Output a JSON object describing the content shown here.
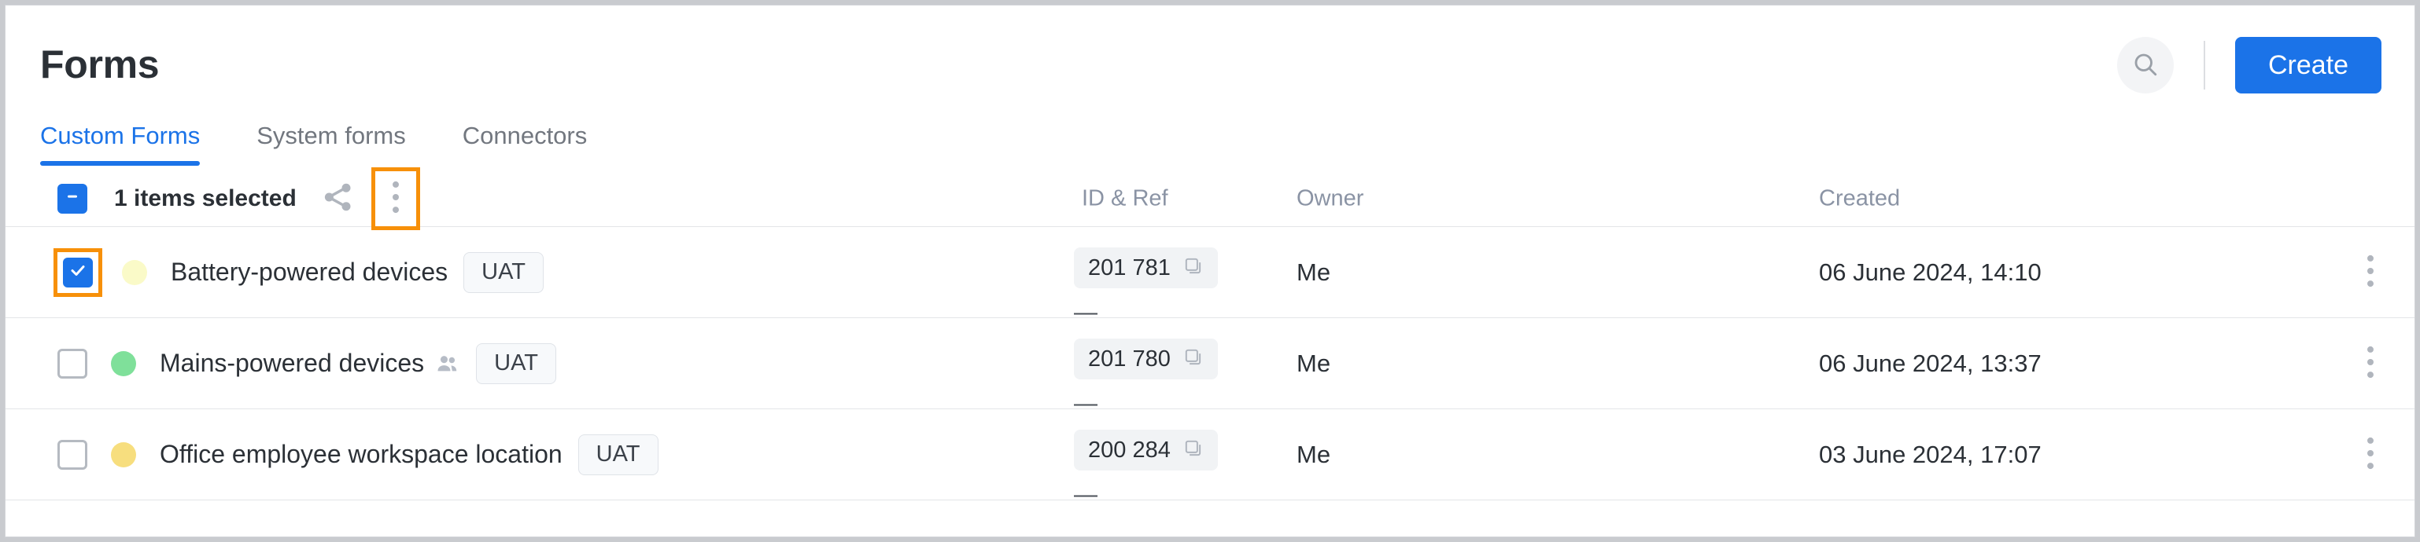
{
  "header": {
    "title": "Forms",
    "search_icon": "search-icon",
    "create_label": "Create"
  },
  "tabs": [
    {
      "label": "Custom Forms",
      "active": true
    },
    {
      "label": "System forms",
      "active": false
    },
    {
      "label": "Connectors",
      "active": false
    }
  ],
  "toolbar": {
    "selection_state": "indeterminate",
    "selected_label": "1 items selected",
    "share_icon": "share-icon",
    "more_icon": "kebab-menu-icon",
    "more_highlighted": true
  },
  "columns": {
    "id_ref": "ID & Ref",
    "owner": "Owner",
    "created": "Created"
  },
  "colors": {
    "accent_blue": "#1b73e8",
    "annotation_orange": "#f79009",
    "status_pale_yellow": "#fafac8",
    "status_green": "#7fe09a",
    "status_amber": "#f7de7e",
    "header_text": "#8a93a4"
  },
  "rows": [
    {
      "checked": true,
      "checkbox_highlighted": true,
      "status_color": "#fafac8",
      "name": "Battery-powered devices",
      "shared": false,
      "badge": "UAT",
      "id": "201 781",
      "ref": "—",
      "owner": "Me",
      "created": "06 June 2024, 14:10"
    },
    {
      "checked": false,
      "checkbox_highlighted": false,
      "status_color": "#7fe09a",
      "name": "Mains-powered devices",
      "shared": true,
      "badge": "UAT",
      "id": "201 780",
      "ref": "—",
      "owner": "Me",
      "created": "06 June 2024, 13:37"
    },
    {
      "checked": false,
      "checkbox_highlighted": false,
      "status_color": "#f7de7e",
      "name": "Office employee workspace location",
      "shared": false,
      "badge": "UAT",
      "id": "200 284",
      "ref": "—",
      "owner": "Me",
      "created": "03 June 2024, 17:07"
    }
  ]
}
